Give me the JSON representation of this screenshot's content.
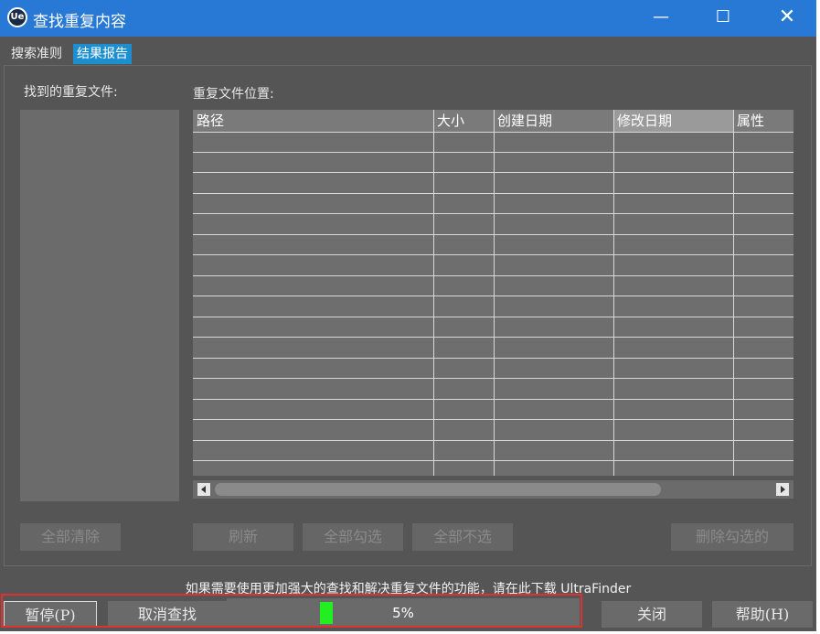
{
  "window": {
    "title": "查找重复内容",
    "app_icon_text": "Ue",
    "controls": {
      "minimize": "—",
      "maximize": "☐",
      "close": "✕"
    }
  },
  "tabs": [
    {
      "label": "搜索准则",
      "active": false
    },
    {
      "label": "结果报告",
      "active": true
    }
  ],
  "found_files": {
    "label": "找到的重复文件:",
    "items": []
  },
  "locations": {
    "label": "重复文件位置:",
    "columns": [
      "路径",
      "大小",
      "创建日期",
      "修改日期",
      "属性"
    ],
    "active_column": "修改日期",
    "rows": []
  },
  "actions": {
    "clear_all": "全部清除",
    "refresh": "刷新",
    "check_all": "全部勾选",
    "uncheck_all": "全部不选",
    "delete_checked": "删除勾选的"
  },
  "promo_text": "如果需要使用更加强大的查找和解决重复文件的功能，请在此下载 UltraFinder",
  "bottom": {
    "pause": "暂停(P)",
    "cancel_search": "取消查找",
    "progress_percent": 5,
    "progress_label": "5%",
    "close": "关闭",
    "help": "帮助(H)"
  },
  "colors": {
    "titlebar": "#2879d6",
    "window_bg": "#555555",
    "active_tab": "#1d8fd0",
    "progress_fill": "#22ee22",
    "highlight_border": "#e03030"
  }
}
